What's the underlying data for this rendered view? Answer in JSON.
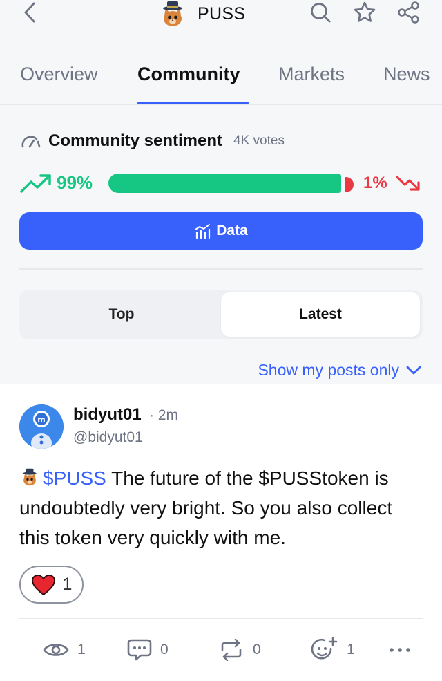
{
  "header": {
    "title": "PUSS",
    "icons": [
      "back-icon",
      "token-logo",
      "search-icon",
      "star-icon",
      "share-icon"
    ]
  },
  "tabs": [
    {
      "label": "Overview",
      "active": false
    },
    {
      "label": "Community",
      "active": true
    },
    {
      "label": "Markets",
      "active": false
    },
    {
      "label": "News",
      "active": false
    }
  ],
  "sentiment": {
    "title": "Community sentiment",
    "votes": "4K votes",
    "bullish_pct": "99%",
    "bearish_pct": "1%",
    "bullish_fraction": 0.99,
    "colors": {
      "bullish": "#16c784",
      "bearish": "#ea3943"
    }
  },
  "data_button": {
    "label": "Data"
  },
  "feed_toggle": {
    "top_label": "Top",
    "latest_label": "Latest",
    "selected": "Latest"
  },
  "filter": {
    "label": "Show my posts only"
  },
  "post": {
    "username": "bidyut01",
    "time": "· 2m",
    "handle": "@bidyut01",
    "ticker": "$PUSS",
    "text": " The future of the $PUSStoken is undoubtedly very bright. So you also collect this token very quickly with me.",
    "reaction_count": "1",
    "views": "1",
    "comments": "0",
    "reposts": "0",
    "reactions": "1"
  },
  "accent_color": "#3861fb"
}
